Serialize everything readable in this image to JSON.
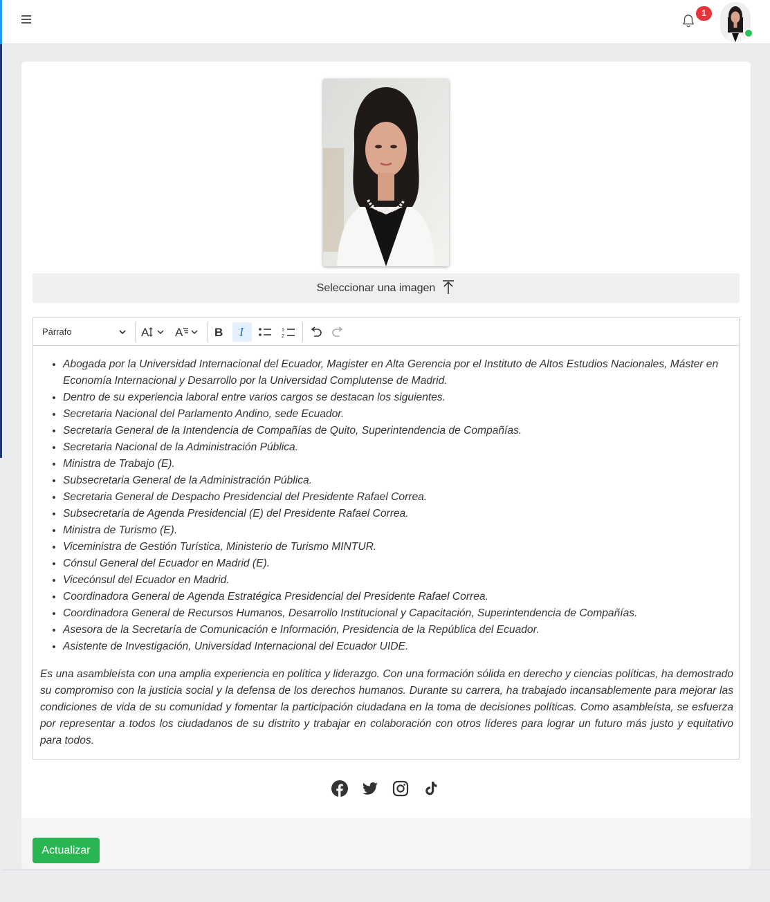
{
  "header": {
    "menu_icon": "hamburger-icon",
    "notification_icon": "bell-icon",
    "notification_count": "1",
    "avatar_status": "online"
  },
  "profile": {
    "select_image_label": "Seleccionar una imagen",
    "select_image_icon": "upload-arrow-icon"
  },
  "editor": {
    "toolbar": {
      "heading_value": "Párrafo",
      "buttons": [
        "font-size-icon",
        "font-family-icon",
        "bold-icon",
        "italic-icon",
        "bulleted-list-icon",
        "numbered-list-icon",
        "undo-icon",
        "redo-icon"
      ],
      "italic_active": true
    },
    "list_items": [
      "Abogada por la Universidad Internacional del Ecuador, Magister en Alta Gerencia por el Instituto de Altos Estudios Nacionales, Máster en Economía Internacional y Desarrollo por la Universidad Complutense de Madrid.",
      "Dentro de su experiencia laboral entre varios cargos se destacan los siguientes.",
      "Secretaria Nacional del Parlamento Andino, sede Ecuador.",
      "Secretaria General de la Intendencia de Compañías de Quito, Superintendencia de Compañías.",
      "Secretaria Nacional de la Administración Pública.",
      "Ministra de Trabajo (E).",
      "Subsecretaria General de la Administración Pública.",
      "Secretaria General de Despacho Presidencial del Presidente Rafael Correa.",
      "Subsecretaria de Agenda Presidencial (E) del Presidente Rafael Correa.",
      "Ministra de Turismo (E).",
      "Viceministra de Gestión Turística, Ministerio de Turismo MINTUR.",
      "Cónsul General del Ecuador en Madrid (E).",
      "Vicecónsul del Ecuador en Madrid.",
      "Coordinadora General de Agenda Estratégica Presidencial del Presidente Rafael Correa.",
      "Coordinadora General de Recursos Humanos, Desarrollo Institucional y Capacitación, Superintendencia de Compañías.",
      "Asesora de la Secretaría de Comunicación e Información, Presidencia de la República del Ecuador.",
      "Asistente de Investigación, Universidad Internacional del Ecuador UIDE."
    ],
    "paragraph": "Es una asambleísta con una amplia experiencia en política y liderazgo. Con una formación sólida en derecho y ciencias políticas, ha demostrado su compromiso con la justicia social y la defensa de los derechos humanos. Durante su carrera, ha trabajado incansablemente para mejorar las condiciones de vida de su comunidad y fomentar la participación ciudadana en la toma de decisiones políticas. Como asambleísta, se esfuerza por representar a todos los ciudadanos de su distrito y trabajar en colaboración con otros líderes para lograr un futuro más justo y equitativo para todos."
  },
  "social": [
    "facebook-icon",
    "twitter-icon",
    "instagram-icon",
    "tiktok-icon"
  ],
  "footer": {
    "update_label": "Actualizar"
  },
  "colors": {
    "accent_blue": "#1e9bf0",
    "sidebar_navy": "#1e3a68",
    "badge_red": "#e5343a",
    "update_green": "#2ab553",
    "status_green": "#28c35c"
  }
}
